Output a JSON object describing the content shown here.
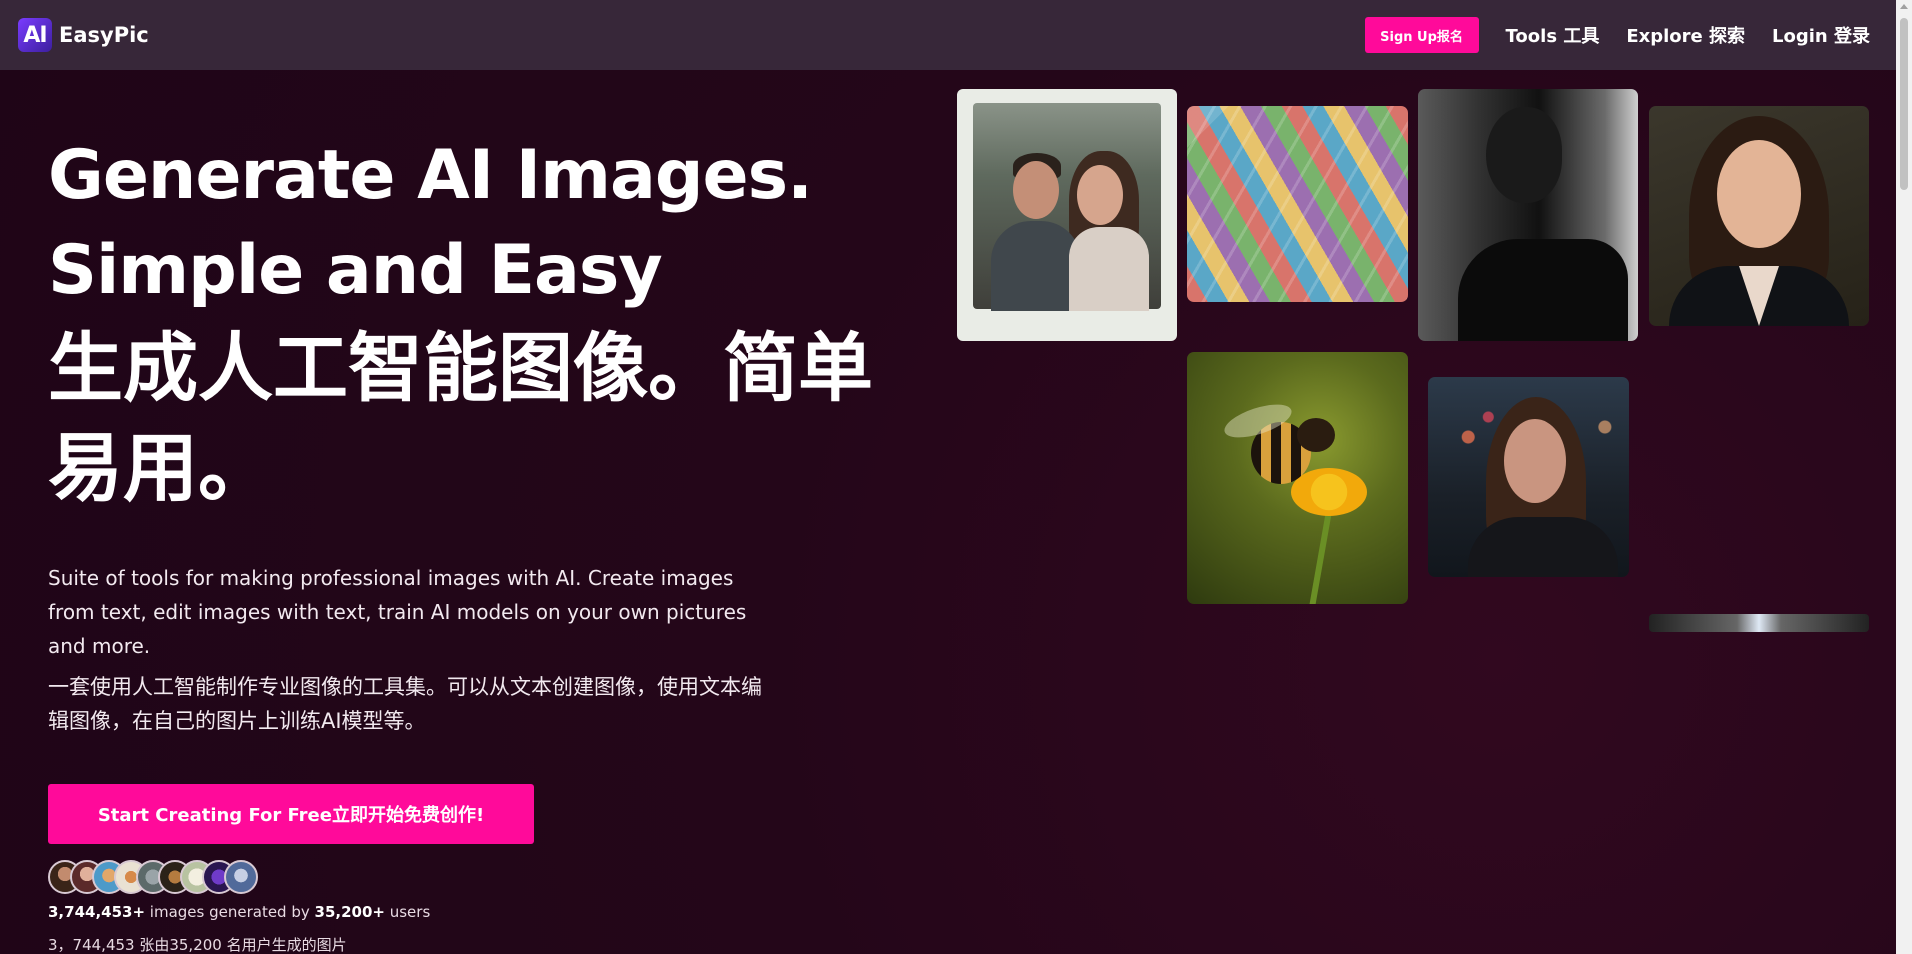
{
  "header": {
    "logo_badge": "AI",
    "logo_text": "EasyPic",
    "signup_label": "Sign Up报名",
    "nav": [
      {
        "label": "Tools 工具"
      },
      {
        "label": "Explore 探索"
      },
      {
        "label": "Login 登录"
      }
    ]
  },
  "hero": {
    "title_line1": "Generate AI Images.",
    "title_line2": "Simple and Easy",
    "title_zh": "生成人工智能图像。简单易用。",
    "description_en": "Suite of tools for making professional images with AI. Create images from text, edit images with text, train AI models on your own pictures and more.",
    "description_zh": "一套使用人工智能制作专业图像的工具集。可以从文本创建图像，使用文本编辑图像，在自己的图片上训练AI模型等。",
    "cta_label": "Start Creating For Free立即开始免费创作!",
    "stats": {
      "images_count": "3,744,453+",
      "images_text": " images generated by ",
      "users_count": "35,200+",
      "users_text": " users"
    },
    "stats_zh": "3，744,453 张由35,200 名用户生成的图片"
  },
  "colors": {
    "accent": "#ff0a9a",
    "background": "#200618",
    "header_bg": "#372739"
  },
  "icons": {
    "logo": "ai-logo-icon",
    "scroll_up": "chevron-up-icon"
  }
}
